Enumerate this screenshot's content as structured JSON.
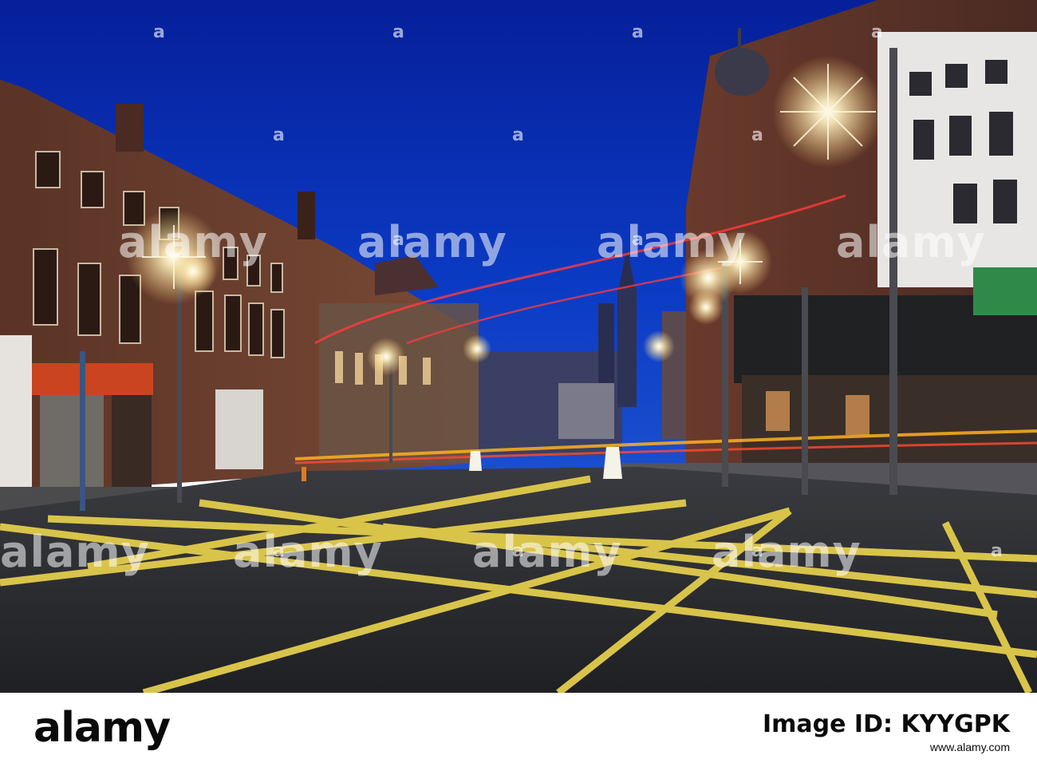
{
  "watermark": {
    "text": "alamy",
    "dot_symbol": "a"
  },
  "footer": {
    "brand": "alamy",
    "image_id_label": "Image ID: KYYGPK",
    "site": "www.alamy.com",
    "image_id": "KYYGPK"
  },
  "colors": {
    "sky": "#0b2fb0",
    "road": "#2a2b2e",
    "box_junction": "#d9c44a",
    "light_trail_red": "#ff3b3b",
    "light_trail_amber": "#ffb020"
  }
}
